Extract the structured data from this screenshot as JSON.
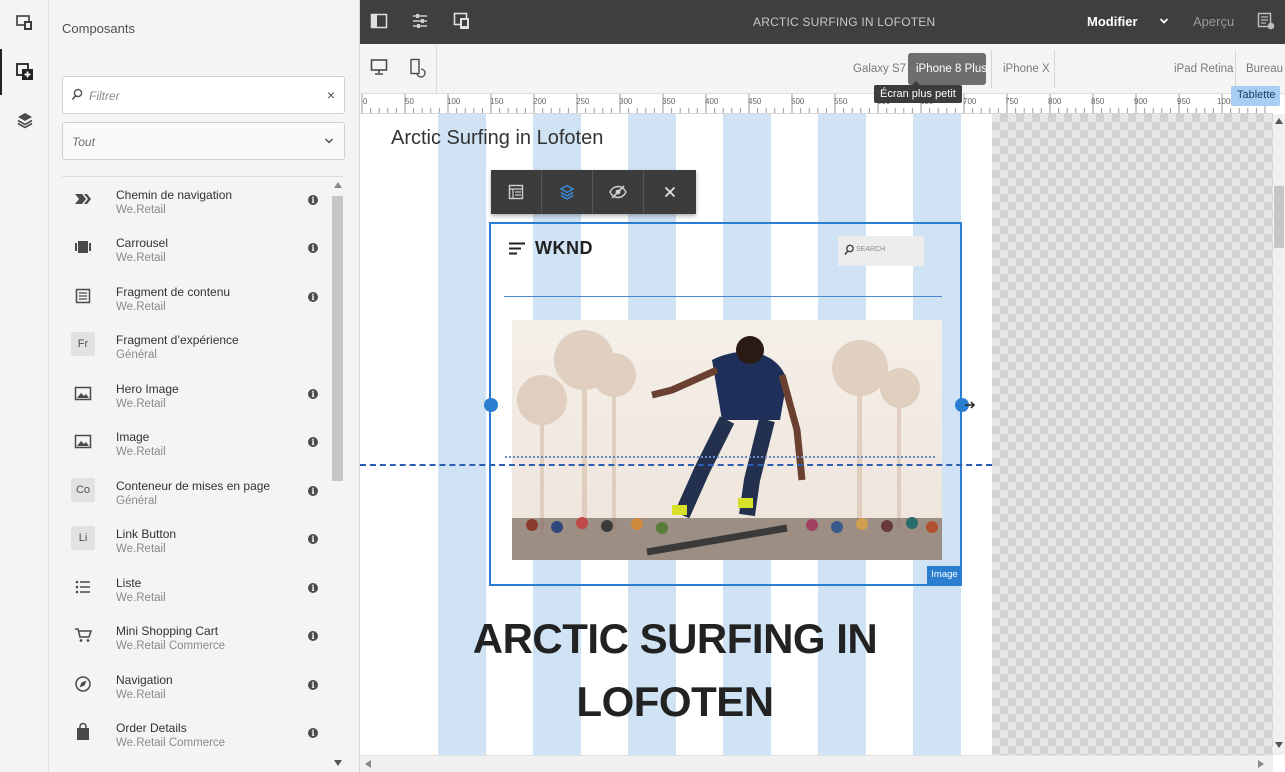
{
  "rail": {
    "items": [
      {
        "name": "emulator-icon"
      },
      {
        "name": "components-icon",
        "active": true
      },
      {
        "name": "layers-icon"
      }
    ]
  },
  "panel": {
    "title": "Composants",
    "filter": {
      "placeholder": "Filtrer",
      "clear_glyph": "×"
    },
    "group_select": {
      "value": "Tout"
    }
  },
  "components": [
    {
      "name": "Chemin de navigation",
      "group": "We.Retail",
      "icon": "breadcrumb-icon",
      "info": true
    },
    {
      "name": "Carrousel",
      "group": "We.Retail",
      "icon": "carousel-icon",
      "info": true
    },
    {
      "name": "Fragment de contenu",
      "group": "We.Retail",
      "icon": "content-fragment-icon",
      "info": true
    },
    {
      "name": "Fragment d’expérience",
      "group": "Général",
      "icon": "Fr",
      "info": false
    },
    {
      "name": "Hero Image",
      "group": "We.Retail",
      "icon": "image-icon",
      "info": true
    },
    {
      "name": "Image",
      "group": "We.Retail",
      "icon": "image-icon",
      "info": true
    },
    {
      "name": "Conteneur de mises en page",
      "group": "Général",
      "icon": "Co",
      "info": true
    },
    {
      "name": "Link Button",
      "group": "We.Retail",
      "icon": "Li",
      "info": true
    },
    {
      "name": "Liste",
      "group": "We.Retail",
      "icon": "list-icon",
      "info": true
    },
    {
      "name": "Mini Shopping Cart",
      "group": "We.Retail Commerce",
      "icon": "cart-icon",
      "info": true
    },
    {
      "name": "Navigation",
      "group": "We.Retail",
      "icon": "compass-icon",
      "info": true
    },
    {
      "name": "Order Details",
      "group": "We.Retail Commerce",
      "icon": "bag-icon",
      "info": true
    }
  ],
  "topbar": {
    "page_title": "ARCTIC SURFING IN LOFOTEN",
    "mode": "Modifier",
    "preview": "Aperçu"
  },
  "devices": {
    "items": [
      "Galaxy S7",
      "iPhone 8 Plus",
      "iPhone X",
      "iPad Retina",
      "Bureau"
    ],
    "selected": "iPhone 8 Plus",
    "tooltip": "Écran plus petit",
    "breakpoint": "Tablette"
  },
  "ruler": {
    "labels": [
      "0",
      "50",
      "100",
      "150",
      "200",
      "250",
      "300",
      "350",
      "400",
      "450",
      "500",
      "550",
      "600",
      "650",
      "700",
      "750",
      "800",
      "850",
      "900",
      "950",
      "1000"
    ]
  },
  "page": {
    "title": "Arctic Surfing in Lofoten",
    "hero": {
      "logo": "WKND",
      "search_placeholder": "SEARCH",
      "badge": "Image"
    },
    "big_title_line1": "ARCTIC SURFING IN",
    "big_title_line2": "LOFOTEN"
  },
  "colors": {
    "accent": "#2c7fd0",
    "topbar": "#3f3f3f",
    "column": "#cfe3f4"
  }
}
